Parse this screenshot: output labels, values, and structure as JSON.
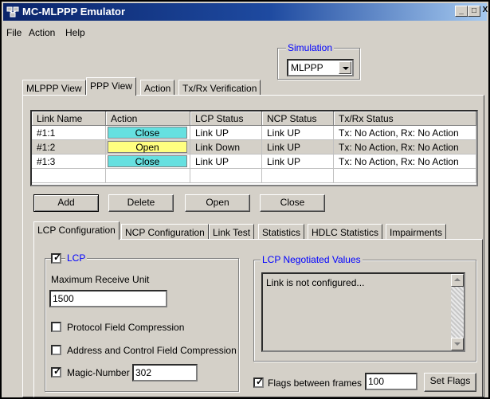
{
  "window": {
    "title": "MC-MLPPP Emulator",
    "minimize": "_",
    "maximize": "□",
    "close": "X",
    "titlebar_color": "#0a246a"
  },
  "menu": [
    {
      "label": "File"
    },
    {
      "label": "Action"
    },
    {
      "label": "Help"
    }
  ],
  "simulation": {
    "label": "Simulation",
    "value": "MLPPP"
  },
  "main_tabs": [
    "MLPPP View",
    "PPP View",
    "Action",
    "Tx/Rx Verification"
  ],
  "active_main_tab": "PPP View",
  "links_table": {
    "columns": [
      "Link Name",
      "Action",
      "LCP Status",
      "NCP Status",
      "Tx/Rx Status"
    ],
    "rows": [
      {
        "name": "#1:1",
        "action": "Close",
        "action_color": "#66e0e0",
        "lcp": "Link UP",
        "ncp": "Link UP",
        "txrx": "Tx: No Action, Rx: No Action"
      },
      {
        "name": "#1:2",
        "action": "Open",
        "action_color": "#ffff80",
        "lcp": "Link Down",
        "ncp": "Link UP",
        "txrx": "Tx: No Action, Rx: No Action"
      },
      {
        "name": "#1:3",
        "action": "Close",
        "action_color": "#66e0e0",
        "lcp": "Link UP",
        "ncp": "Link UP",
        "txrx": "Tx: No Action, Rx: No Action"
      }
    ]
  },
  "link_buttons": {
    "add": "Add",
    "delete": "Delete",
    "open": "Open",
    "close": "Close"
  },
  "sub_tabs": [
    "LCP Configuration",
    "NCP Configuration",
    "Link Test",
    "Statistics",
    "HDLC Statistics",
    "Impairments"
  ],
  "active_sub_tab": "LCP Configuration",
  "lcp": {
    "group_label": "LCP",
    "enabled": true,
    "mru_label": "Maximum Receive Unit",
    "mru_value": "1500",
    "pfc_label": "Protocol Field Compression",
    "pfc_checked": false,
    "acfc_label": "Address and Control Field Compression",
    "acfc_checked": false,
    "magic_label": "Magic-Number",
    "magic_checked": true,
    "magic_value": "302",
    "label_color": "#0000ff"
  },
  "negotiated": {
    "label": "LCP Negotiated Values",
    "text": "Link is not configured..."
  },
  "flags": {
    "label": "Flags between frames",
    "checked": true,
    "value": "100",
    "button": "Set Flags"
  }
}
